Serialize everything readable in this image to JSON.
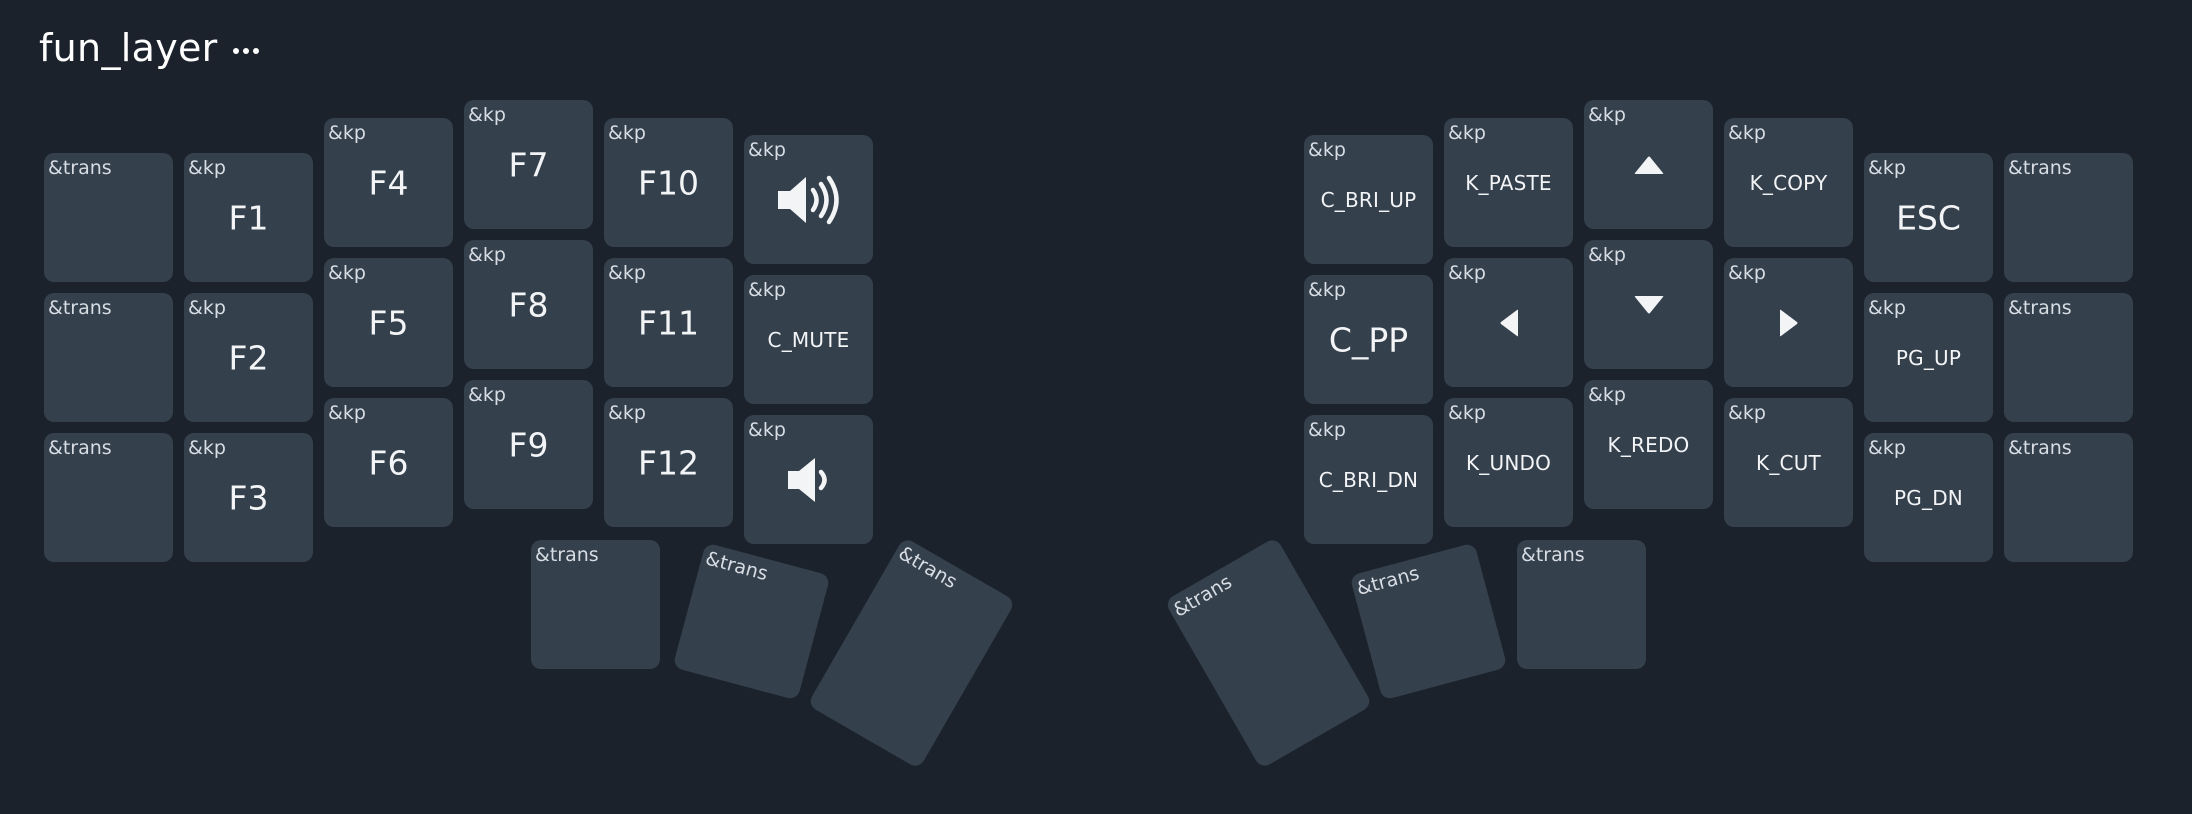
{
  "layer": {
    "title": "fun_layer",
    "more_icon": "more-horizontal-icon"
  },
  "left_keys": {
    "c0": [
      {
        "hold": "&trans",
        "tap": ""
      },
      {
        "hold": "&trans",
        "tap": ""
      },
      {
        "hold": "&trans",
        "tap": ""
      }
    ],
    "c1": [
      {
        "hold": "&kp",
        "tap": "F1"
      },
      {
        "hold": "&kp",
        "tap": "F2"
      },
      {
        "hold": "&kp",
        "tap": "F3"
      }
    ],
    "c2": [
      {
        "hold": "&kp",
        "tap": "F4"
      },
      {
        "hold": "&kp",
        "tap": "F5"
      },
      {
        "hold": "&kp",
        "tap": "F6"
      }
    ],
    "c3": [
      {
        "hold": "&kp",
        "tap": "F7"
      },
      {
        "hold": "&kp",
        "tap": "F8"
      },
      {
        "hold": "&kp",
        "tap": "F9"
      }
    ],
    "c4": [
      {
        "hold": "&kp",
        "tap": "F10"
      },
      {
        "hold": "&kp",
        "tap": "F11"
      },
      {
        "hold": "&kp",
        "tap": "F12"
      }
    ],
    "c5": [
      {
        "hold": "&kp",
        "tap": "",
        "icon": "volume-up-icon"
      },
      {
        "hold": "&kp",
        "tap": "C_MUTE"
      },
      {
        "hold": "&kp",
        "tap": "",
        "icon": "volume-down-icon"
      }
    ]
  },
  "left_thumbs": [
    {
      "hold": "&trans"
    },
    {
      "hold": "&trans"
    },
    {
      "hold": "&trans"
    }
  ],
  "right_keys": {
    "c0": [
      {
        "hold": "&kp",
        "tap": "C_BRI_UP"
      },
      {
        "hold": "&kp",
        "tap": "C_PP"
      },
      {
        "hold": "&kp",
        "tap": "C_BRI_DN"
      }
    ],
    "c1": [
      {
        "hold": "&kp",
        "tap": "K_PASTE"
      },
      {
        "hold": "&kp",
        "tap": "",
        "icon": "arrow-left-icon"
      },
      {
        "hold": "&kp",
        "tap": "K_UNDO"
      }
    ],
    "c2": [
      {
        "hold": "&kp",
        "tap": "",
        "icon": "arrow-up-icon"
      },
      {
        "hold": "&kp",
        "tap": "",
        "icon": "arrow-down-icon"
      },
      {
        "hold": "&kp",
        "tap": "K_REDO"
      }
    ],
    "c3": [
      {
        "hold": "&kp",
        "tap": "K_COPY"
      },
      {
        "hold": "&kp",
        "tap": "",
        "icon": "arrow-right-icon"
      },
      {
        "hold": "&kp",
        "tap": "K_CUT"
      }
    ],
    "c4": [
      {
        "hold": "&kp",
        "tap": "ESC"
      },
      {
        "hold": "&kp",
        "tap": "PG_UP"
      },
      {
        "hold": "&kp",
        "tap": "PG_DN"
      }
    ],
    "c5": [
      {
        "hold": "&trans",
        "tap": ""
      },
      {
        "hold": "&trans",
        "tap": ""
      },
      {
        "hold": "&trans",
        "tap": ""
      }
    ]
  },
  "right_thumbs": [
    {
      "hold": "&trans"
    },
    {
      "hold": "&trans"
    },
    {
      "hold": "&trans"
    }
  ]
}
